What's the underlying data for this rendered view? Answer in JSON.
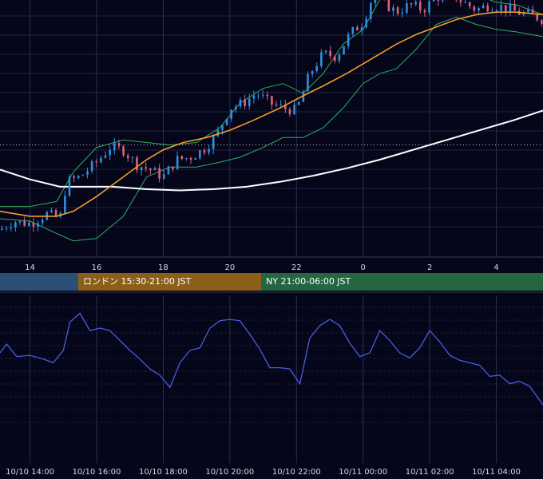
{
  "chart_data": [
    {
      "type": "candlestick",
      "title": "",
      "x_tick_labels": [
        "14",
        "16",
        "18",
        "20",
        "22",
        "0",
        "2",
        "4"
      ],
      "x_hours": [
        14,
        16,
        18,
        20,
        22,
        24,
        26,
        28
      ],
      "x_range": [
        13.1,
        29.4
      ],
      "y_range": [
        0,
        100
      ],
      "grid": true,
      "reference_line_y": 43,
      "colors": {
        "up": "#2f8fe0",
        "down": "#e0607a",
        "ma_short": "#f39c2a",
        "ma_long": "#ffffff",
        "bollinger": "#2fae62"
      },
      "series": [
        {
          "key": "close",
          "x": [
            13.1,
            13.5,
            14.0,
            14.5,
            14.9,
            15.1,
            15.5,
            16.0,
            16.4,
            16.8,
            17.2,
            17.6,
            18.0,
            18.4,
            18.8,
            19.2,
            19.6,
            20.0,
            20.4,
            20.8,
            21.2,
            21.6,
            22.0,
            22.4,
            22.8,
            23.2,
            23.6,
            24.0,
            24.3,
            24.6,
            25.0,
            25.4,
            25.8,
            26.2,
            26.6,
            27.0,
            27.4,
            27.8,
            28.2,
            28.6,
            29.0,
            29.4
          ],
          "values": [
            8.5,
            12,
            11,
            15,
            13,
            28,
            30,
            36,
            42,
            41,
            35,
            33,
            30,
            37,
            38,
            41,
            47,
            58,
            60,
            64,
            60,
            58,
            57,
            72,
            80,
            79,
            88,
            93,
            104,
            101,
            97,
            100,
            98,
            103,
            105,
            101,
            98,
            100,
            99,
            97,
            96,
            94
          ]
        },
        {
          "key": "ma_short",
          "x": [
            13.1,
            14.0,
            14.8,
            15.3,
            16.0,
            16.8,
            17.5,
            18.0,
            18.6,
            19.3,
            20.0,
            20.7,
            21.5,
            22.2,
            22.8,
            23.5,
            24.0,
            24.5,
            25.0,
            25.6,
            26.2,
            26.8,
            27.4,
            28.0,
            28.6,
            29.4
          ],
          "values": [
            16,
            14,
            14,
            16,
            22,
            30,
            37,
            41,
            44,
            46,
            49,
            53,
            58,
            63,
            67,
            72,
            76,
            80,
            84,
            88,
            91,
            94,
            96,
            97,
            97,
            96
          ]
        },
        {
          "key": "ma_long",
          "x": [
            13.1,
            14.0,
            14.9,
            15.5,
            16.5,
            17.5,
            18.5,
            19.5,
            20.5,
            21.5,
            22.5,
            23.5,
            24.5,
            25.5,
            26.5,
            27.5,
            28.5,
            29.4
          ],
          "values": [
            33,
            29,
            26,
            26,
            26,
            25,
            24.5,
            25,
            26,
            28,
            30.5,
            33.5,
            37,
            41,
            45,
            49,
            53,
            57
          ]
        },
        {
          "key": "bb_upper",
          "x": [
            13.1,
            14.0,
            14.8,
            15.3,
            16.0,
            16.8,
            17.5,
            18.2,
            19.0,
            19.7,
            20.3,
            21.0,
            21.6,
            22.2,
            22.8,
            23.4,
            24.0,
            24.5,
            25.0,
            25.6,
            26.2,
            26.8,
            27.4,
            28.0,
            28.6,
            29.4
          ],
          "values": [
            18,
            18,
            20,
            32,
            42,
            45,
            44,
            43,
            44,
            50,
            60,
            66,
            68,
            64,
            72,
            84,
            90,
            102,
            104,
            106,
            108,
            107,
            104,
            101,
            100,
            96
          ]
        },
        {
          "key": "bb_lower",
          "x": [
            13.1,
            14.0,
            14.8,
            15.3,
            16.0,
            16.8,
            17.5,
            18.2,
            19.0,
            19.7,
            20.3,
            21.0,
            21.6,
            22.2,
            22.8,
            23.4,
            24.0,
            24.5,
            25.0,
            25.6,
            26.2,
            26.8,
            27.4,
            28.0,
            28.6,
            29.4
          ],
          "values": [
            13,
            12,
            7,
            4,
            5,
            14,
            30,
            34,
            34,
            36,
            38,
            42,
            46,
            46,
            50,
            58,
            68,
            72,
            74,
            82,
            92,
            95,
            92,
            90,
            89,
            87
          ]
        }
      ]
    },
    {
      "type": "line",
      "title": "",
      "x_tick_labels": [
        "10/10 14:00",
        "10/10 16:00",
        "10/10 18:00",
        "10/10 20:00",
        "10/10 22:00",
        "10/11 00:00",
        "10/11 02:00",
        "10/11 04:00"
      ],
      "x_hours": [
        14,
        16,
        18,
        20,
        22,
        24,
        26,
        28
      ],
      "x_range": [
        13.1,
        29.4
      ],
      "y_range": [
        0,
        100
      ],
      "grid": true,
      "series": [
        {
          "key": "oscillator",
          "x": [
            13.1,
            13.3,
            13.6,
            14.0,
            14.4,
            14.7,
            15.0,
            15.2,
            15.5,
            15.8,
            16.1,
            16.4,
            16.7,
            17.0,
            17.3,
            17.6,
            17.9,
            18.2,
            18.5,
            18.8,
            19.1,
            19.4,
            19.7,
            20.0,
            20.3,
            20.6,
            20.9,
            21.2,
            21.5,
            21.8,
            22.1,
            22.4,
            22.7,
            23.0,
            23.3,
            23.6,
            23.9,
            24.2,
            24.5,
            24.8,
            25.1,
            25.4,
            25.7,
            26.0,
            26.3,
            26.6,
            26.9,
            27.2,
            27.5,
            27.8,
            28.1,
            28.4,
            28.7,
            29.0,
            29.4
          ],
          "values": [
            60,
            67,
            57,
            58,
            55,
            52,
            62,
            85,
            92,
            78,
            80,
            78,
            70,
            62,
            55,
            47,
            42,
            32,
            52,
            62,
            64,
            80,
            86,
            87,
            86,
            75,
            63,
            48,
            48,
            47,
            35,
            72,
            82,
            87,
            82,
            68,
            57,
            60,
            78,
            70,
            60,
            56,
            64,
            78,
            69,
            58,
            54,
            52,
            50,
            41,
            42,
            35,
            37,
            33,
            18
          ]
        }
      ]
    }
  ],
  "sessions": [
    {
      "label": "",
      "color": "#2c4f78"
    },
    {
      "label": "ロンドン 15:30-21:00 JST",
      "color": "#8b5e1a",
      "start": 15.5,
      "end": 21.0
    },
    {
      "label": "NY 21:00-06:00 JST",
      "color": "#246640",
      "start": 21.0,
      "end": 30.0
    }
  ]
}
